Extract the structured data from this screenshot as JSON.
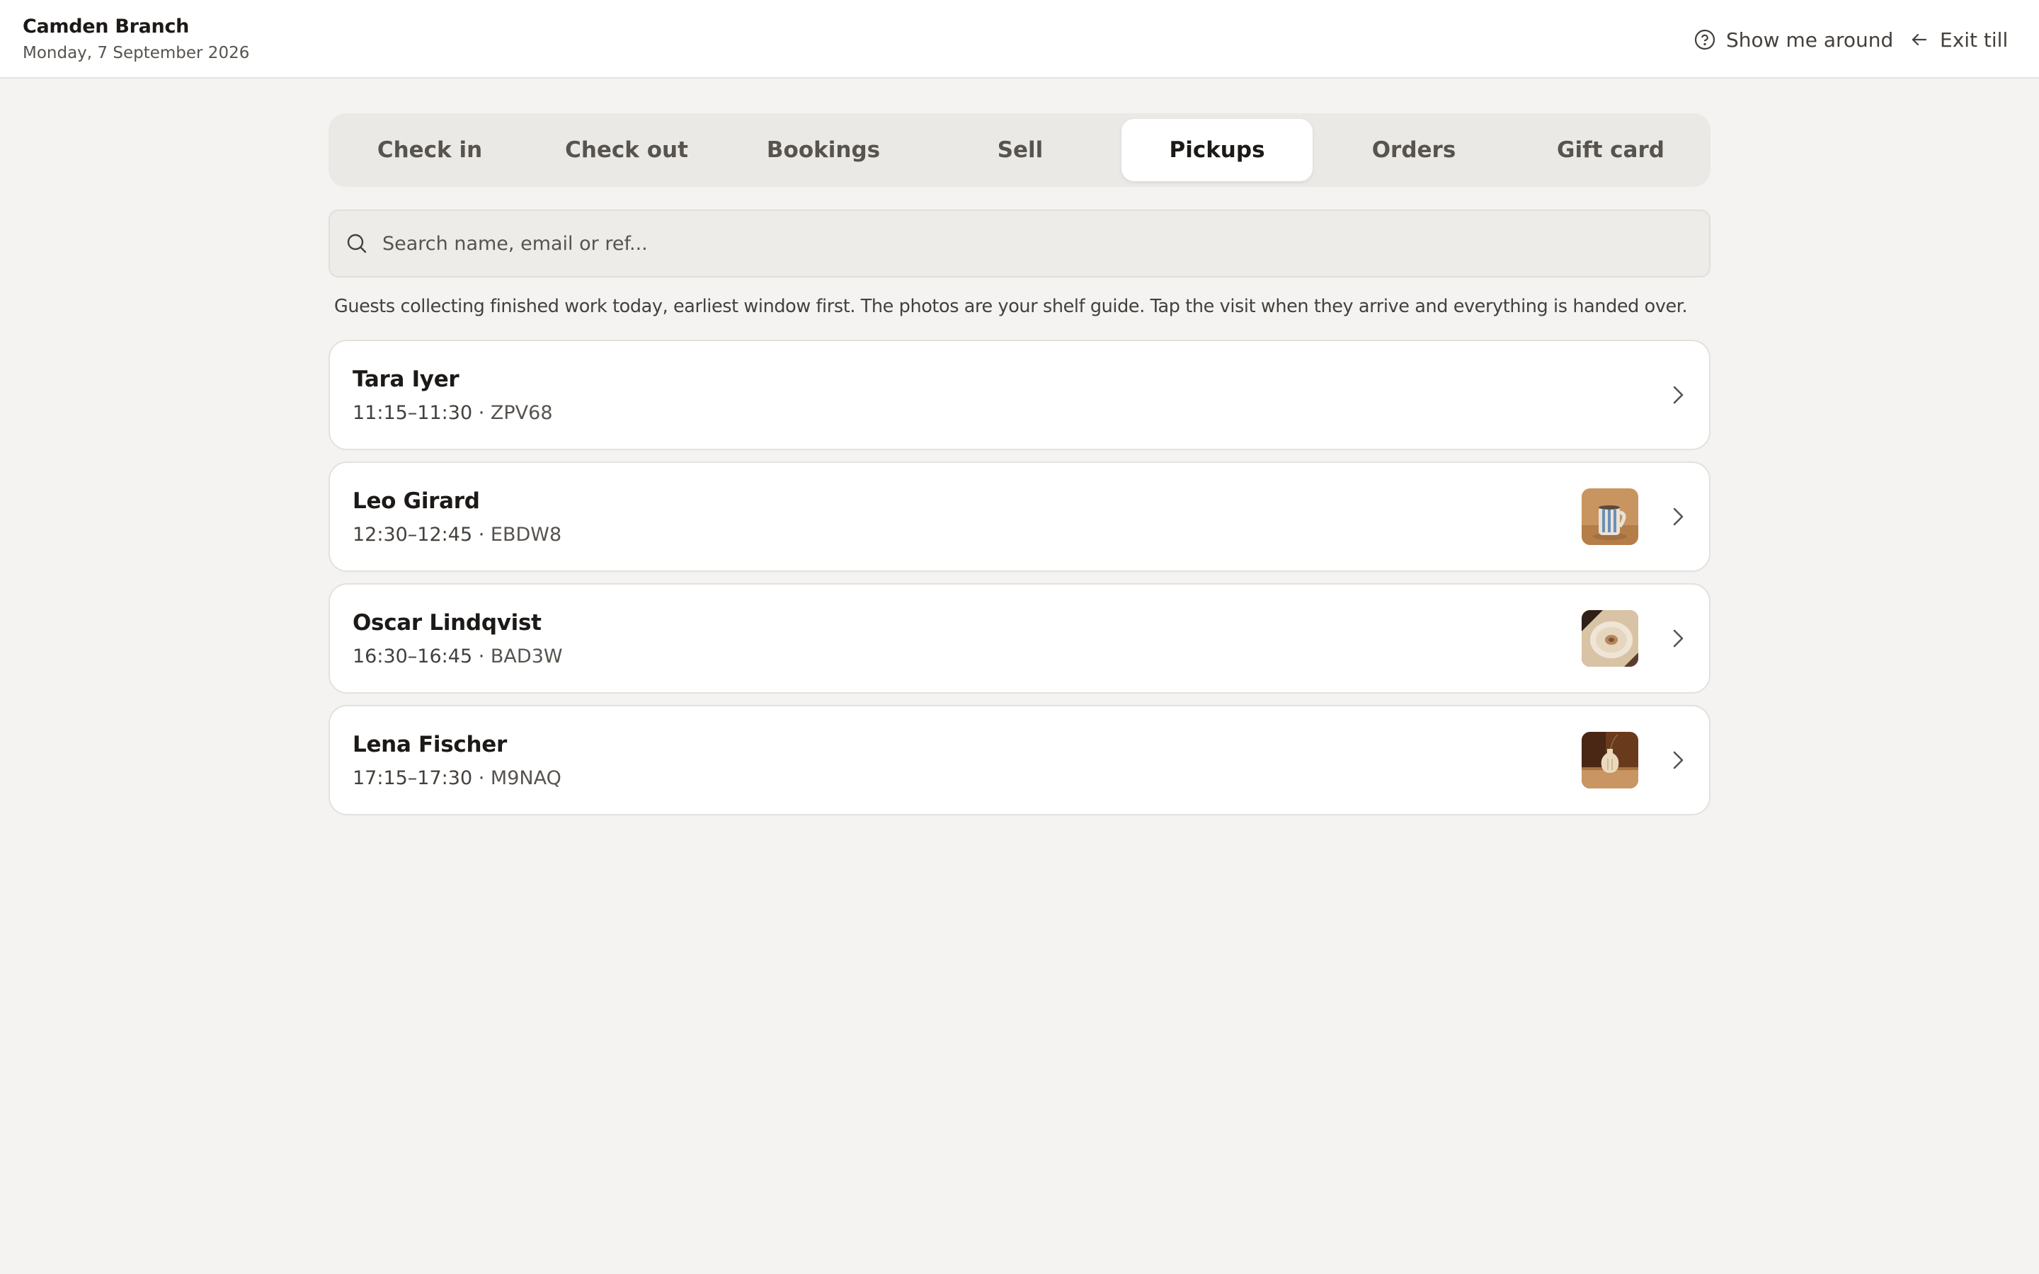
{
  "header": {
    "branch": "Camden Branch",
    "date": "Monday, 7 September 2026",
    "help_label": "Show me around",
    "exit_label": "Exit till"
  },
  "tabs": [
    {
      "label": "Check in",
      "active": false
    },
    {
      "label": "Check out",
      "active": false
    },
    {
      "label": "Bookings",
      "active": false
    },
    {
      "label": "Sell",
      "active": false
    },
    {
      "label": "Pickups",
      "active": true
    },
    {
      "label": "Orders",
      "active": false
    },
    {
      "label": "Gift card",
      "active": false
    }
  ],
  "search": {
    "placeholder": "Search name, email or ref...",
    "value": ""
  },
  "hint": "Guests collecting finished work today, earliest window first. The photos are your shelf guide. Tap the visit when they arrive and everything is handed over.",
  "pickups": [
    {
      "name": "Tara Iyer",
      "window": "11:15–11:30",
      "separator": "·",
      "ref": "ZPV68",
      "photo": null
    },
    {
      "name": "Leo Girard",
      "window": "12:30–12:45",
      "separator": "·",
      "ref": "EBDW8",
      "photo": "striped-mug-photo"
    },
    {
      "name": "Oscar Lindqvist",
      "window": "16:30–16:45",
      "separator": "·",
      "ref": "BAD3W",
      "photo": "ceramic-plate-photo"
    },
    {
      "name": "Lena Fischer",
      "window": "17:15–17:30",
      "separator": "·",
      "ref": "M9NAQ",
      "photo": "vase-photo"
    }
  ],
  "colors": {
    "background": "#f4f3f1",
    "surface": "#ffffff",
    "text": "#1c1917",
    "muted": "#57534e",
    "border": "#e4e1dc"
  }
}
